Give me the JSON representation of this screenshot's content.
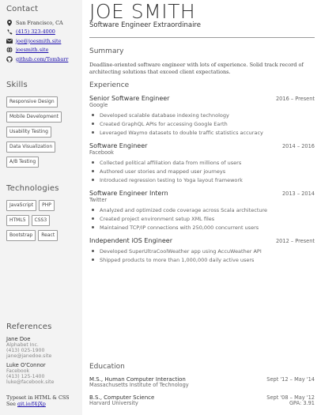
{
  "sidebar": {
    "contact_heading": "Contact",
    "contact": [
      {
        "icon": "map-pin-icon",
        "text": "San Francisco, CA",
        "link": false
      },
      {
        "icon": "phone-icon",
        "text": "(415) 323-4000",
        "link": true
      },
      {
        "icon": "email-icon",
        "text": "joe@joesmith.site",
        "link": true
      },
      {
        "icon": "globe-icon",
        "text": "joesmith.site",
        "link": true
      },
      {
        "icon": "github-icon",
        "text": "github.com/Tombarr",
        "link": true
      }
    ],
    "skills_heading": "Skills",
    "skills": [
      "Responsive Design",
      "Mobile Development",
      "Usability Testing",
      "Data Visualization",
      "A/B Testing"
    ],
    "tech_heading": "Technologies",
    "technologies": [
      "JavaScript",
      "PHP",
      "HTML5",
      "CSS3",
      "Bootstrap",
      "React"
    ],
    "references_heading": "References",
    "references": [
      {
        "name": "Jane Doe",
        "lines": [
          "Alphabet Inc.",
          "(413) 025-1900",
          "jane@janedoe.site"
        ]
      },
      {
        "name": "Luke O'Connor",
        "lines": [
          "Facebook",
          "(413) 125-1400",
          "luke@facebook.site"
        ]
      }
    ],
    "typeset_text": "Typeset in HTML & CSS",
    "see_text": "See",
    "see_link": "git.io/f4jXp"
  },
  "main": {
    "name": "JOE SMITH",
    "title": "Software Engineer Extraordinaire",
    "summary_heading": "Summary",
    "summary": "Deadline-oriented software engineer with lots of experience. Solid track record of architecting solutions that exceed client expectations.",
    "experience_heading": "Experience",
    "jobs": [
      {
        "title": "Senior Software Engineer",
        "dates": "2016 – Present",
        "company": "Google",
        "bullets": [
          "Developed scalable database indexing technology",
          "Created GraphQL APIs for accessing Google Earth",
          "Leveraged Waymo datasets to double traffic statistics accuracy"
        ]
      },
      {
        "title": "Software Engineer",
        "dates": "2014 – 2016",
        "company": "Facebook",
        "bullets": [
          "Collected political affiliation data from millions of users",
          "Authored user stories and mapped user journeys",
          "Introduced regression testing to Yoga layout framework"
        ]
      },
      {
        "title": "Software Engineer Intern",
        "dates": "2013 – 2014",
        "company": "Twitter",
        "bullets": [
          "Analyzed and optimized code coverage across Scala architecture",
          "Created project environment setup XML files",
          "Maintained TCP/IP connections with 250,000 concurrent users"
        ]
      },
      {
        "title": "Independent iOS Engineer",
        "dates": "2012 – Present",
        "company": "",
        "bullets": [
          "Developed SuperUltraCoolWeather app using AccuWeather API",
          "Shipped products to more than 1,000,000 daily active users"
        ]
      }
    ],
    "education_heading": "Education",
    "education": [
      {
        "degree": "M.S., Human Computer Interaction",
        "dates": "Sept '12 – May '14",
        "school": "Massachusetts Institute of Technology",
        "gpa": ""
      },
      {
        "degree": "B.S., Computer Science",
        "dates": "Sept '08 – May '12",
        "school": "Harvard University",
        "gpa": "GPA: 3.91"
      }
    ]
  }
}
